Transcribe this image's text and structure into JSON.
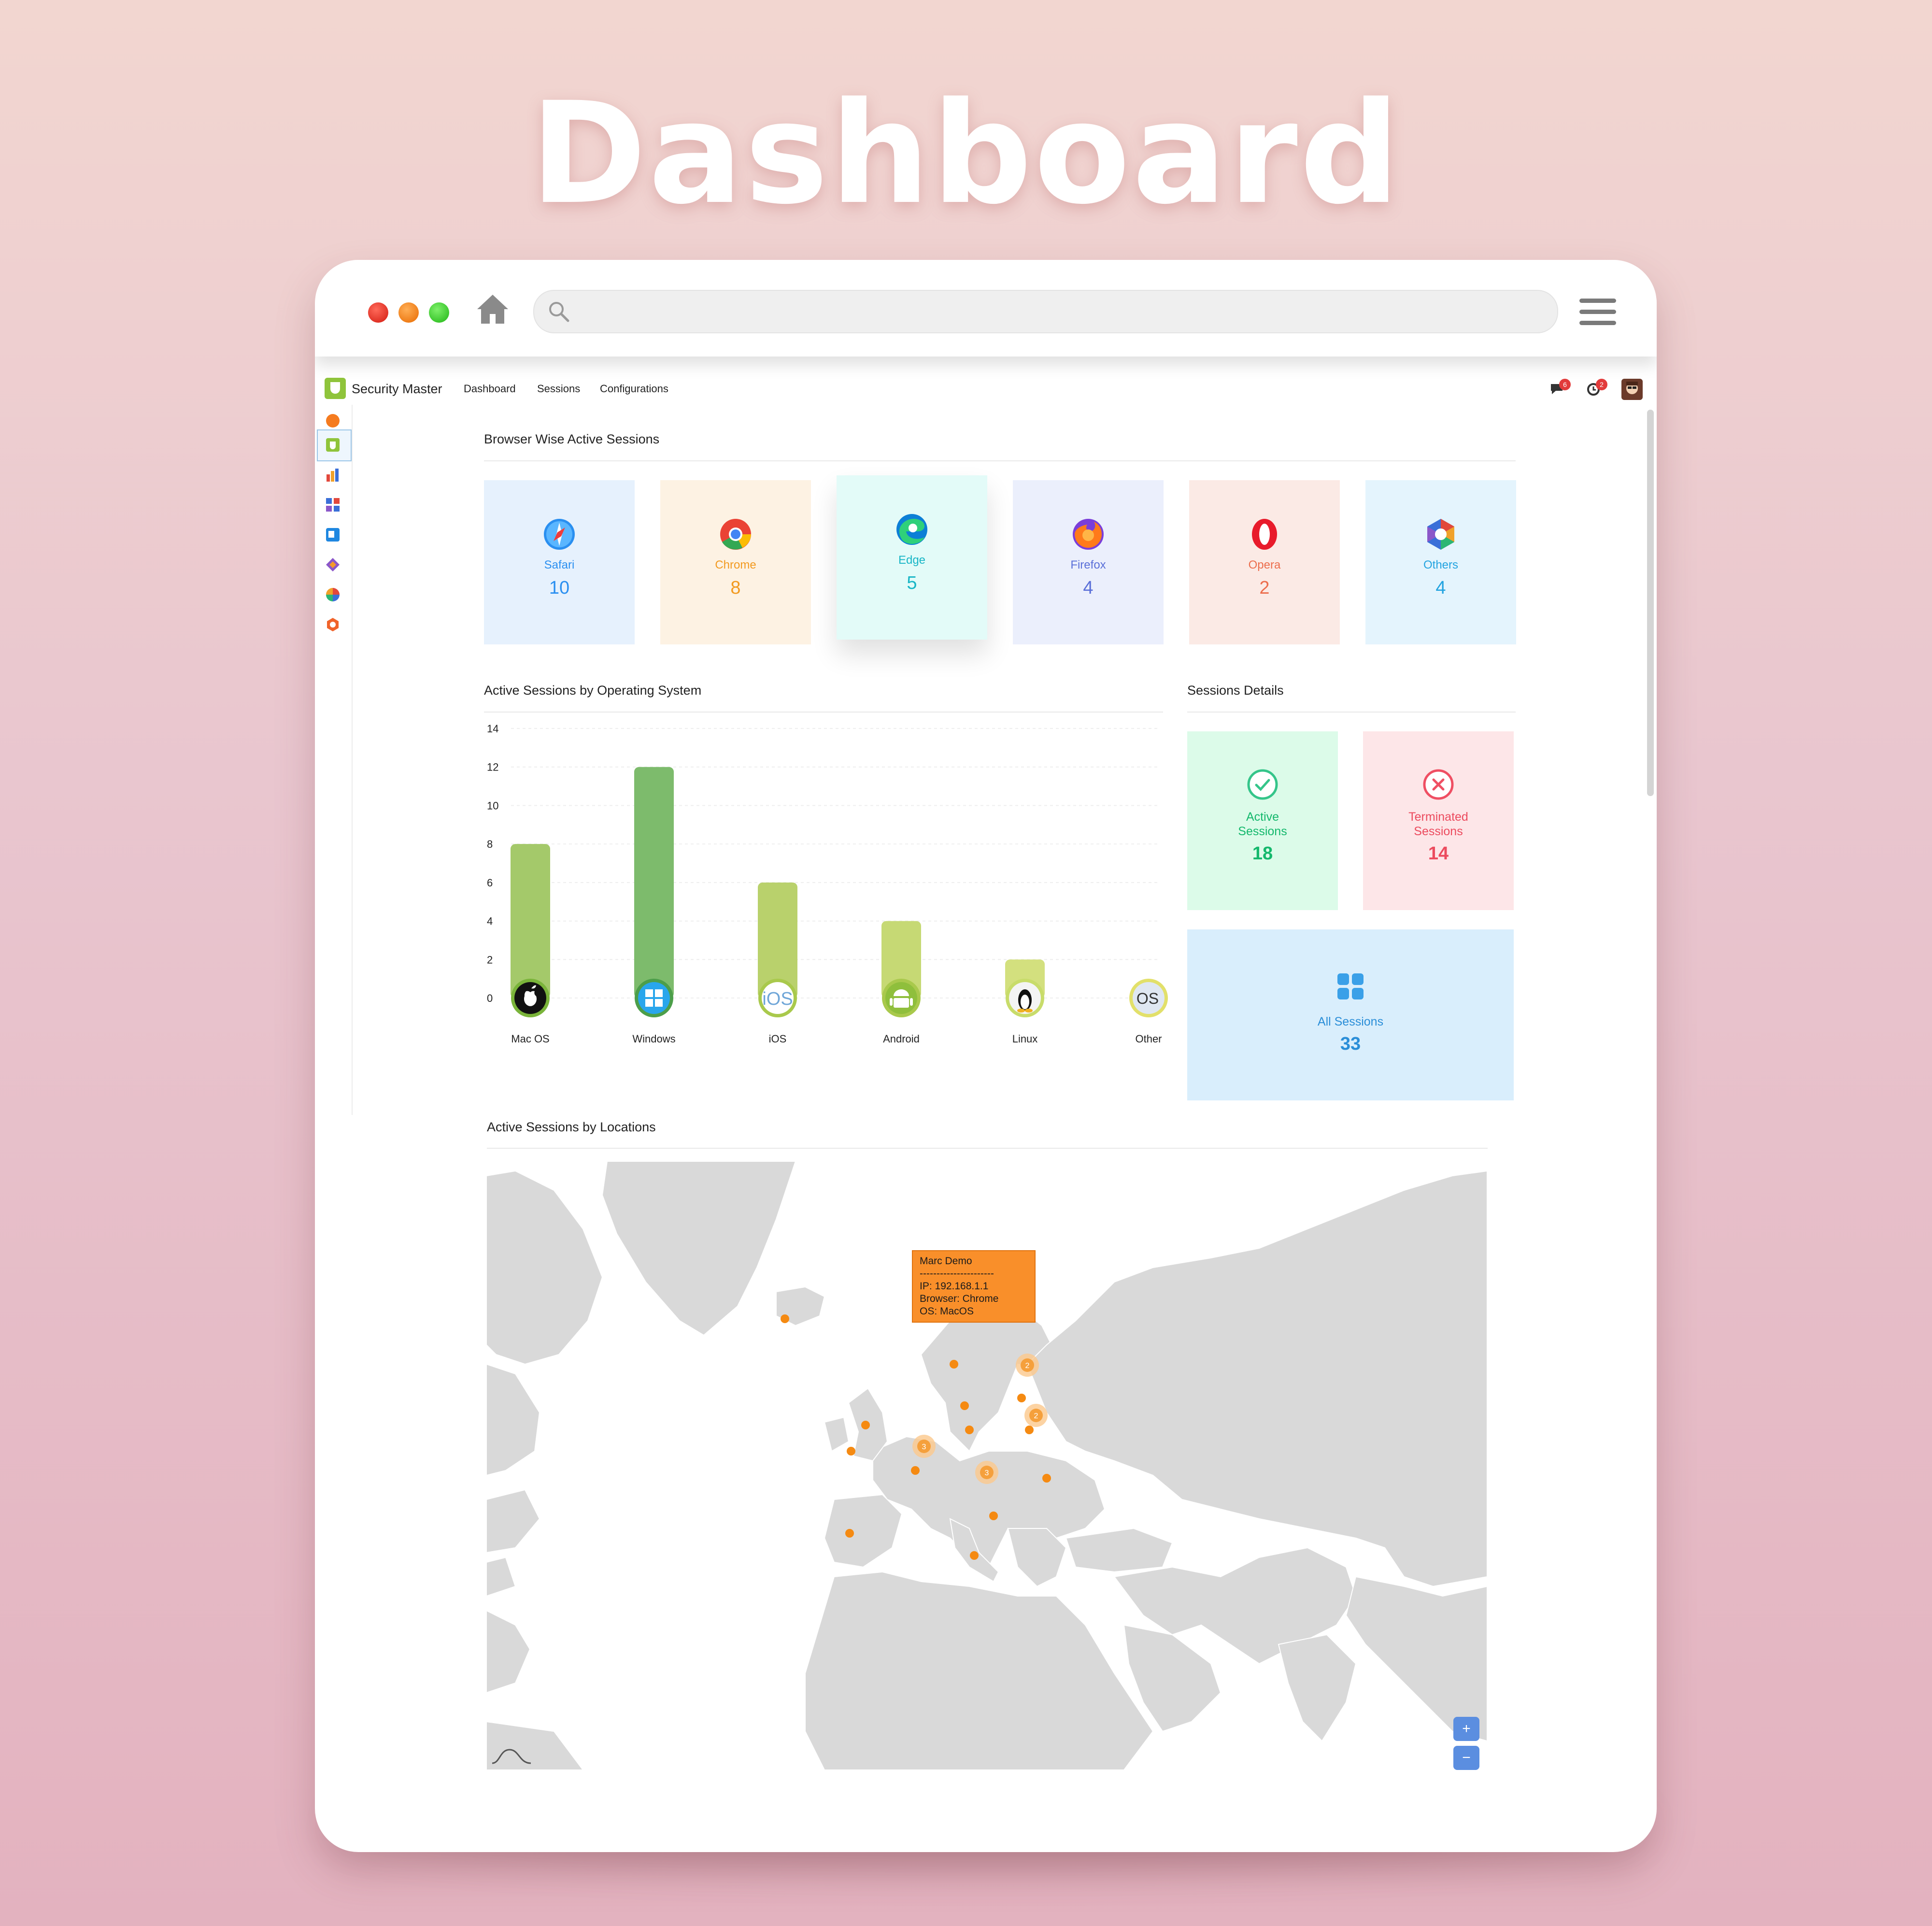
{
  "hero_title": "Dashboard",
  "app": {
    "brand": "Security Master",
    "nav": [
      "Dashboard",
      "Sessions",
      "Configurations"
    ],
    "notifications_badge": "6",
    "alerts_badge": "2"
  },
  "browser_section": {
    "title": "Browser Wise Active Sessions",
    "cards": [
      {
        "label": "Safari",
        "value": "10",
        "icon": "safari-icon",
        "color": "#2a8ff0",
        "bg": "#e6f1fd"
      },
      {
        "label": "Chrome",
        "value": "8",
        "icon": "chrome-icon",
        "color": "#f29a20",
        "bg": "#fdf2e3"
      },
      {
        "label": "Edge",
        "value": "5",
        "icon": "edge-icon",
        "color": "#18b6c6",
        "bg": "#e3fbf8"
      },
      {
        "label": "Firefox",
        "value": "4",
        "icon": "firefox-icon",
        "color": "#5a6fd8",
        "bg": "#ebeffc"
      },
      {
        "label": "Opera",
        "value": "2",
        "icon": "opera-icon",
        "color": "#ec6d4c",
        "bg": "#fbeae5"
      },
      {
        "label": "Others",
        "value": "4",
        "icon": "others-icon",
        "color": "#22a3e0",
        "bg": "#e4f4fd"
      }
    ]
  },
  "os_section": {
    "title": "Active Sessions by Operating System"
  },
  "chart_data": {
    "type": "bar",
    "categories": [
      "Mac OS",
      "Windows",
      "iOS",
      "Android",
      "Linux",
      "Other"
    ],
    "values": [
      8,
      12,
      6,
      4,
      2,
      0
    ],
    "ylim": [
      0,
      14
    ],
    "yticks": [
      "0",
      "2",
      "4",
      "6",
      "8",
      "10",
      "12",
      "14"
    ],
    "colors": [
      "#a4c96a",
      "#7dbb6c",
      "#b9d16c",
      "#c6d974",
      "#d3e07e",
      "#e0e08c"
    ],
    "icons": [
      "apple-icon",
      "windows-icon",
      "ios-icon",
      "android-icon",
      "linux-icon",
      "other-os-icon"
    ],
    "grid": true
  },
  "sessions_details": {
    "title": "Sessions Details",
    "active": {
      "label_1": "Active",
      "label_2": "Sessions",
      "value": "18",
      "color": "#14b86c",
      "bg": "#dcfbe9"
    },
    "terminated": {
      "label_1": "Terminated",
      "label_2": "Sessions",
      "value": "14",
      "color": "#ec4b5e",
      "bg": "#fde6e8"
    },
    "all": {
      "label": "All Sessions",
      "value": "33",
      "color": "#2a8ed8",
      "bg": "#d9eefc"
    }
  },
  "locations_section": {
    "title": "Active Sessions by Locations",
    "clusters": [
      "2",
      "2",
      "3",
      "3"
    ],
    "tooltip": {
      "name": "Marc Demo",
      "separator": "----------------------",
      "ip": "IP: 192.168.1.1",
      "browser": "Browser: Chrome",
      "os": "OS: MacOS"
    },
    "zoom_in": "+",
    "zoom_out": "−"
  }
}
